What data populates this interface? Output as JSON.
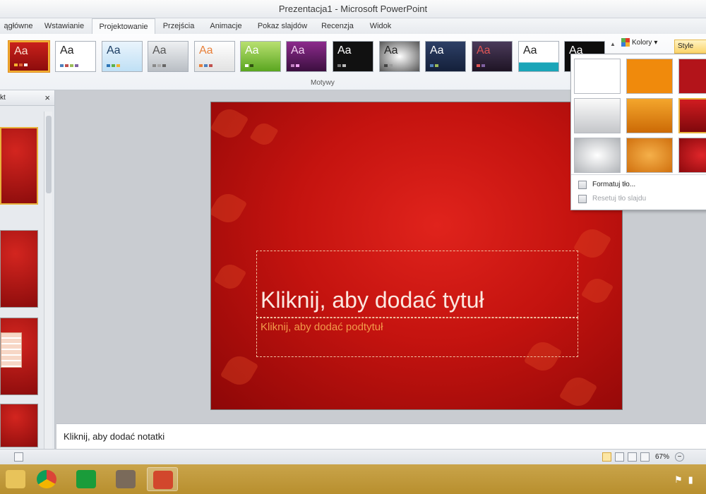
{
  "window": {
    "title": "Prezentacja1 - Microsoft PowerPoint"
  },
  "tabs": [
    {
      "label": "ągłówne"
    },
    {
      "label": "Wstawianie"
    },
    {
      "label": "Projektowanie"
    },
    {
      "label": "Przejścia"
    },
    {
      "label": "Animacje"
    },
    {
      "label": "Pokaz slajdów"
    },
    {
      "label": "Recenzja"
    },
    {
      "label": "Widok"
    }
  ],
  "ribbon": {
    "theme_sample": "Aa",
    "group_label": "Motywy",
    "colors_label": "Kolory",
    "styles_label": "Style"
  },
  "left_panel": {
    "header_label": "kt",
    "close_glyph": "×"
  },
  "slide": {
    "title_placeholder": "Kliknij, aby dodać tytuł",
    "subtitle_placeholder": "Kliknij, aby dodać podtytuł"
  },
  "background_menu": {
    "format_label": "Formatuj tło...",
    "reset_label": "Resetuj tło slajdu"
  },
  "notes": {
    "placeholder": "Kliknij, aby dodać notatki"
  },
  "status": {
    "zoom": "67%",
    "zoom_out_glyph": "−"
  },
  "colors": {
    "accent": "#c4130f",
    "ribbon_highlight": "#f2b233"
  }
}
